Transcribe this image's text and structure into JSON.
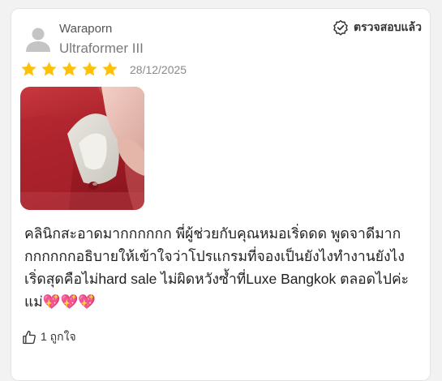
{
  "review": {
    "reviewer_name": "Waraporn",
    "product_name": "Ultraformer III",
    "verified_label": "ตรวจสอบแล้ว",
    "rating": 5,
    "rating_max": 5,
    "date": "28/12/2025",
    "text": "คลินิกสะอาดมากกกกกก พี่ผู้ช่วยกับคุณหมอเริ่ดดด พูดจาดีมาก\nกกกกกกอธิบายให้เข้าใจว่าโปรแกรมที่จองเป็นยังไงทำงานยังไง\nเริ่ดสุดคือไม่hard sale ไม่ผิดหวังซ้ำที่Luxe Bangkok ตลอดไปค่ะ\nแม่💖💖💖",
    "like_label": "1 ถูกใจ"
  },
  "colors": {
    "star": "#FFC107",
    "avatar": "#C4C4C4"
  }
}
